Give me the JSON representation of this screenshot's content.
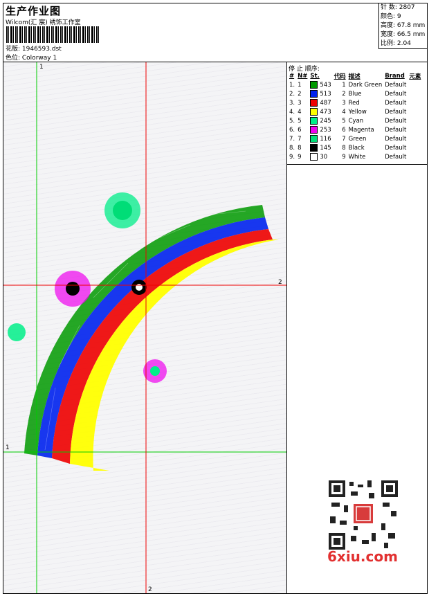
{
  "header": {
    "title": "生产作业图",
    "company": "Wilcom(汇 宸) 绣饰工作室",
    "design_label": "花版: 1946593.dst",
    "colorway_label": "色位: Colorway 1"
  },
  "stats": {
    "stitches": "针 数: 2807",
    "colors": "颜色: 9",
    "height": "高度: 67.8 mm",
    "width": "宽度: 66.5 mm",
    "scale": "比例: 2.04"
  },
  "thread_panel": {
    "title": "停 止 顺序:",
    "headers": [
      "#",
      "N#",
      "St.",
      "代码",
      "描述",
      "Brand",
      "元素"
    ],
    "rows": [
      {
        "num": "1.",
        "n": "1",
        "color": "#009900",
        "st": "543",
        "code": "1",
        "desc": "Dark Green",
        "brand": "Default"
      },
      {
        "num": "2.",
        "n": "2",
        "color": "#0022ee",
        "st": "513",
        "code": "2",
        "desc": "Blue",
        "brand": "Default"
      },
      {
        "num": "3.",
        "n": "3",
        "color": "#ee0000",
        "st": "487",
        "code": "3",
        "desc": "Red",
        "brand": "Default"
      },
      {
        "num": "4.",
        "n": "4",
        "color": "#ffff00",
        "st": "473",
        "code": "4",
        "desc": "Yellow",
        "brand": "Default"
      },
      {
        "num": "5.",
        "n": "5",
        "color": "#00ee88",
        "st": "245",
        "code": "5",
        "desc": "Cyan",
        "brand": "Default"
      },
      {
        "num": "6.",
        "n": "6",
        "color": "#ee00ee",
        "st": "253",
        "code": "6",
        "desc": "Magenta",
        "brand": "Default"
      },
      {
        "num": "7.",
        "n": "7",
        "color": "#00dd77",
        "st": "116",
        "code": "7",
        "desc": "Green",
        "brand": "Default"
      },
      {
        "num": "8.",
        "n": "8",
        "color": "#000000",
        "st": "145",
        "code": "8",
        "desc": "Black",
        "brand": "Default"
      },
      {
        "num": "9.",
        "n": "9",
        "color": "#ffffff",
        "st": "30",
        "code": "9",
        "desc": "White",
        "brand": "Default"
      }
    ]
  },
  "guides": {
    "green_label_1": "1",
    "green_label_2": "1",
    "red_label_1": "2",
    "red_label_2": "2"
  },
  "watermark": "6xiu.com",
  "colors": {
    "green_guide": "#00cc00",
    "red_guide": "#ee0000"
  }
}
